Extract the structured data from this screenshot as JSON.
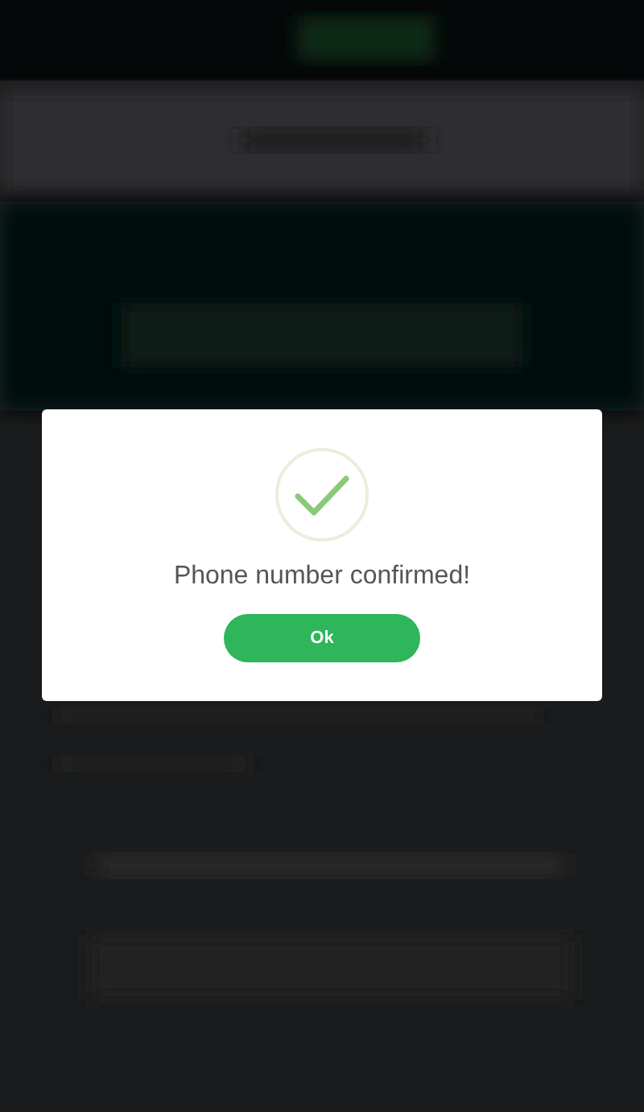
{
  "dialog": {
    "message": "Phone number confirmed!",
    "button": "Ok"
  }
}
